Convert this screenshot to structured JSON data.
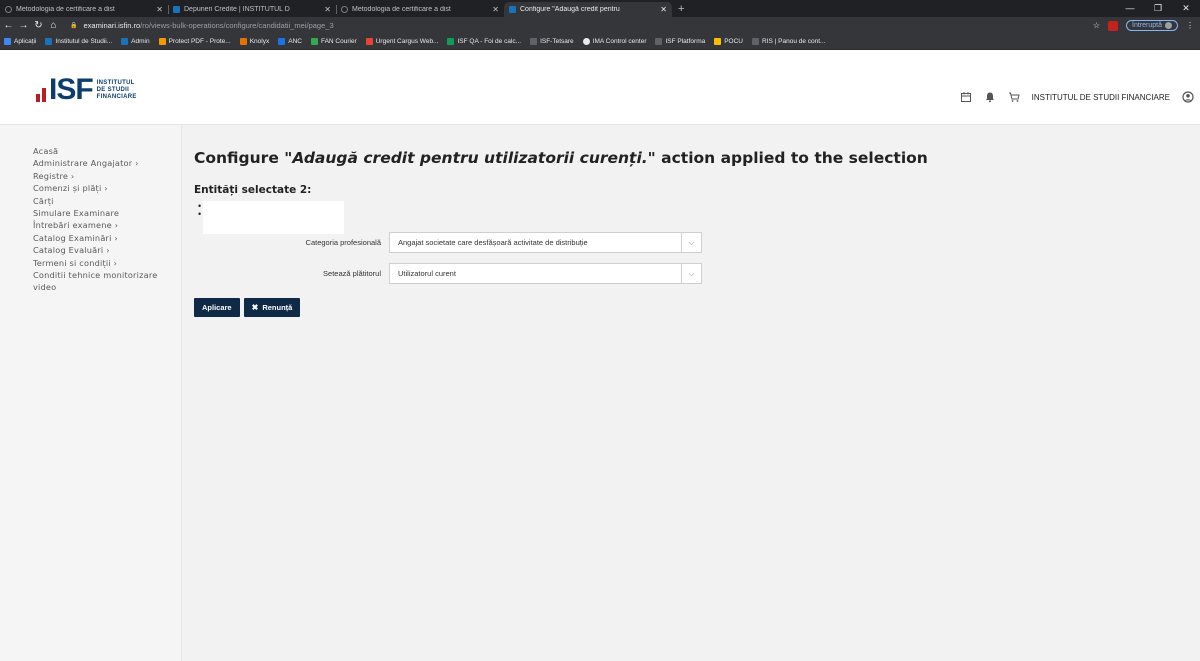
{
  "browser": {
    "tabs": [
      {
        "title": "Metodologia de certificare a dist",
        "active": false
      },
      {
        "title": "Depuneri Credite | INSTITUTUL D",
        "active": false
      },
      {
        "title": "Metodologia de certificare a dist",
        "active": false
      },
      {
        "title": "Configure \"Adaugă credit pentru",
        "active": true
      }
    ],
    "new_tab": "+",
    "url_domain": "examinari.isfin.ro",
    "url_path": "/ro/views-bulk-operations/configure/candidatii_mei/page_3",
    "paused_label": "Întreruptă",
    "bookmarks": [
      {
        "label": "Aplicații",
        "icon": "apps-grid-icon"
      },
      {
        "label": "Institutul de Studii...",
        "icon": "isf-icon"
      },
      {
        "label": "Admin",
        "icon": "isf-icon"
      },
      {
        "label": "Protect PDF - Prote...",
        "icon": "pdf-icon"
      },
      {
        "label": "Knolyx",
        "icon": "knolyx-icon"
      },
      {
        "label": "ANC",
        "icon": "anc-icon"
      },
      {
        "label": "FAN Courier",
        "icon": "fan-icon"
      },
      {
        "label": "Urgent Cargus Web...",
        "icon": "cargus-icon"
      },
      {
        "label": "ISF QA - Foi de calc...",
        "icon": "sheets-icon"
      },
      {
        "label": "ISF-Tetsare",
        "icon": "link-icon"
      },
      {
        "label": "IMA Control center",
        "icon": "github-icon"
      },
      {
        "label": "ISF Platforma",
        "icon": "link-icon"
      },
      {
        "label": "POCU",
        "icon": "fs-icon"
      },
      {
        "label": "RIS | Panou de cont...",
        "icon": "link-icon"
      }
    ]
  },
  "header": {
    "logo_word": "ISF",
    "logo_sub": [
      "INSTITUTUL",
      "DE STUDII",
      "FINANCIARE"
    ],
    "org_name": "INSTITUTUL DE STUDII FINANCIARE"
  },
  "sidebar": {
    "items": [
      "Acasă",
      "Administrare Angajator ›",
      "Registre ›",
      "Comenzi și plăți ›",
      "Cărți",
      "Simulare Examinare",
      "Întrebări examene ›",
      "Catalog Examinări ›",
      "Catalog Evaluări ›",
      "Termeni si condiții ›",
      "Conditii tehnice monitorizare",
      "video"
    ]
  },
  "main": {
    "title_prefix": "Configure \"",
    "title_action": "Adaugă credit pentru utilizatorii curenți.",
    "title_suffix": "\" action applied to the selection",
    "selected_heading": "Entități selectate 2:",
    "fields": [
      {
        "label": "Categoria profesională",
        "value": "Angajat societate care desfășoară activitate de distribuție"
      },
      {
        "label": "Setează plătitorul",
        "value": "Utilizatorul curent"
      }
    ],
    "apply_label": "Aplicare",
    "cancel_label": "Renunță"
  },
  "colors": {
    "brand_navy": "#0c3d6e",
    "brand_red": "#b51f24",
    "button_bg": "#0e2a47"
  }
}
